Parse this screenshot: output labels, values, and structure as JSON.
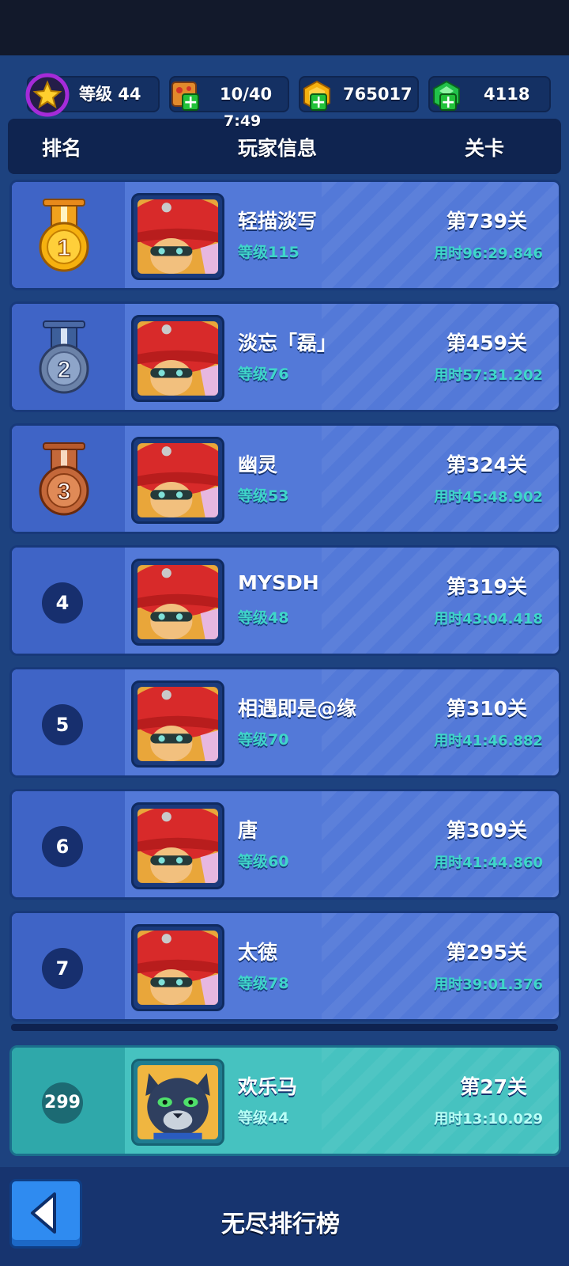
{
  "resources": {
    "level_label": "等级 44",
    "energy": "10/40",
    "energy_timer": "7:49",
    "coins": "765017",
    "gems": "4118"
  },
  "header": {
    "rank": "排名",
    "player_info": "玩家信息",
    "stage": "关卡"
  },
  "rows": [
    {
      "rank": "1",
      "name": "轻描淡写",
      "level": "等级115",
      "stage": "第739关",
      "time": "用时96:29.846"
    },
    {
      "rank": "2",
      "name": "淡忘「磊」",
      "level": "等级76",
      "stage": "第459关",
      "time": "用时57:31.202"
    },
    {
      "rank": "3",
      "name": "幽灵",
      "level": "等级53",
      "stage": "第324关",
      "time": "用时45:48.902"
    },
    {
      "rank": "4",
      "name": "MYSDH",
      "level": "等级48",
      "stage": "第319关",
      "time": "用时43:04.418"
    },
    {
      "rank": "5",
      "name": "相遇即是@缘",
      "level": "等级70",
      "stage": "第310关",
      "time": "用时41:46.882"
    },
    {
      "rank": "6",
      "name": "唐",
      "level": "等级60",
      "stage": "第309关",
      "time": "用时41:44.860"
    },
    {
      "rank": "7",
      "name": "太徳",
      "level": "等级78",
      "stage": "第295关",
      "time": "用时39:01.376"
    }
  ],
  "me": {
    "rank": "299",
    "name": "欢乐马",
    "level": "等级44",
    "stage": "第27关",
    "time": "用时13:10.029"
  },
  "bottom": {
    "title": "无尽排行榜"
  },
  "icons": {
    "level": "star-icon",
    "energy": "pizza-icon",
    "coins": "coin-icon",
    "gems": "gem-icon",
    "back": "back-arrow-icon"
  },
  "colors": {
    "row_bg": "#5379d8",
    "me_row_bg": "#46c2c0",
    "accent_text": "#3fd6c9",
    "gold": "#f6b10f",
    "silver": "#6b82a8",
    "bronze": "#c4683a"
  }
}
